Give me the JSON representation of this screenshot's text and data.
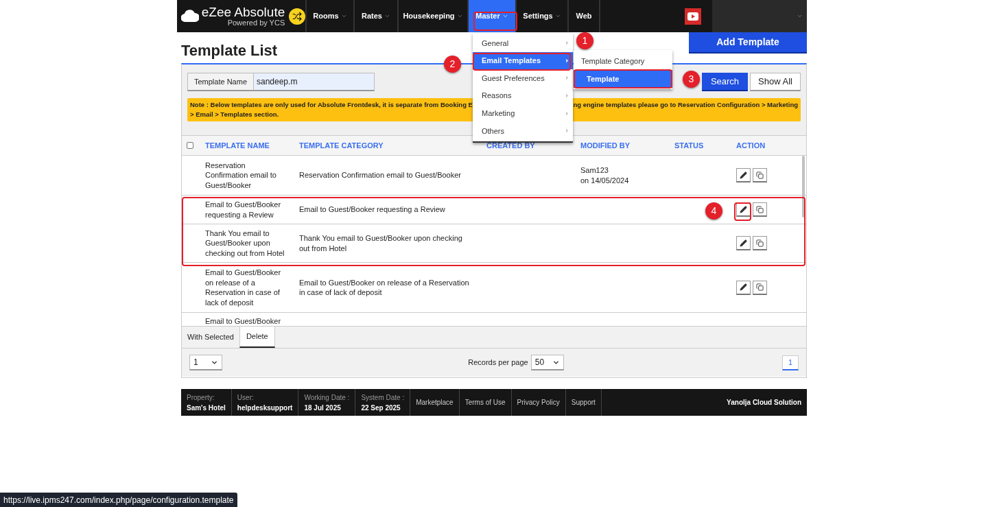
{
  "nav": {
    "logo_title": "eZee Absolute",
    "logo_subtitle": "Powered by YCS",
    "items": [
      {
        "label": "Rooms",
        "selected": false,
        "caret": true
      },
      {
        "label": "Rates",
        "selected": false,
        "caret": true
      },
      {
        "label": "Housekeeping",
        "selected": false,
        "caret": true
      },
      {
        "label": "Master",
        "selected": true,
        "caret": true
      },
      {
        "label": "Settings",
        "selected": false,
        "caret": true
      },
      {
        "label": "Web",
        "selected": false,
        "caret": false
      }
    ]
  },
  "page_title": "Template List",
  "add_button": "Add Template",
  "menu": {
    "items": [
      {
        "label": "General",
        "selected": false
      },
      {
        "label": "Email Templates",
        "selected": true
      },
      {
        "label": "Guest Preferences",
        "selected": false
      },
      {
        "label": "Reasons",
        "selected": false
      },
      {
        "label": "Marketing",
        "selected": false
      },
      {
        "label": "Others",
        "selected": false
      }
    ],
    "submenu": [
      {
        "label": "Template Category",
        "selected": false
      },
      {
        "label": "Template",
        "selected": true
      }
    ]
  },
  "search": {
    "label": "Template Name",
    "value": "sandeep.m",
    "search_button": "Search",
    "show_all_button": "Show All"
  },
  "note": {
    "line1_start": "Note : Below templates are only used for Absolute Frontdesk, it is separate from Booking E",
    "line1_end": "ng engine templates please go to Reservation Configuration > Marketing",
    "line2": "> Email > Templates section."
  },
  "table": {
    "select_all_checked": false,
    "columns": [
      "TEMPLATE NAME",
      "TEMPLATE CATEGORY",
      "CREATED BY",
      "MODIFIED BY",
      "STATUS",
      "ACTION"
    ],
    "rows": [
      {
        "name": "Reservation Confirmation email to Guest/Booker",
        "category": "Reservation Confirmation email to Guest/Booker",
        "modified_by": "Sam123",
        "modified_on": "on 14/05/2024",
        "actions": true
      },
      {
        "name": "Email to Guest/Booker requesting a Review",
        "category": "Email to Guest/Booker requesting a Review",
        "actions": true
      },
      {
        "name": "Thank You email to Guest/Booker upon checking out from Hotel",
        "category": "Thank You email to Guest/Booker upon checking out from Hotel",
        "actions": true
      },
      {
        "name": "Email to Guest/Booker on release of a Reservation in case of lack of deposit",
        "category": "Email to Guest/Booker on release of a Reservation in case of lack of deposit",
        "actions": true
      },
      {
        "name": "Email to Guest/Booker",
        "actions": false
      }
    ]
  },
  "bulk": {
    "label": "With Selected",
    "actions": [
      "Delete"
    ]
  },
  "pagination": {
    "page_select": "1",
    "records_label": "Records per page",
    "records_value": "50",
    "pages": [
      {
        "label": "1",
        "selected": true
      }
    ]
  },
  "footer": {
    "fields": [
      {
        "label": "Property:",
        "value": "Sam's Hotel"
      },
      {
        "label": "User:",
        "value": "helpdesksupport"
      },
      {
        "label": "Working Date :",
        "value": "18 Jul 2025"
      },
      {
        "label": "System Date :",
        "value": "22 Sep 2025"
      }
    ],
    "links": [
      "Marketplace",
      "Terms of Use",
      "Privacy Policy",
      "Support"
    ],
    "brand": "Yanolja Cloud Solution"
  },
  "status_url": "https://live.ipms247.com/index.php/page/configuration.template",
  "annotations": [
    {
      "label": "1"
    },
    {
      "label": "2"
    },
    {
      "label": "3"
    },
    {
      "label": "4"
    }
  ]
}
